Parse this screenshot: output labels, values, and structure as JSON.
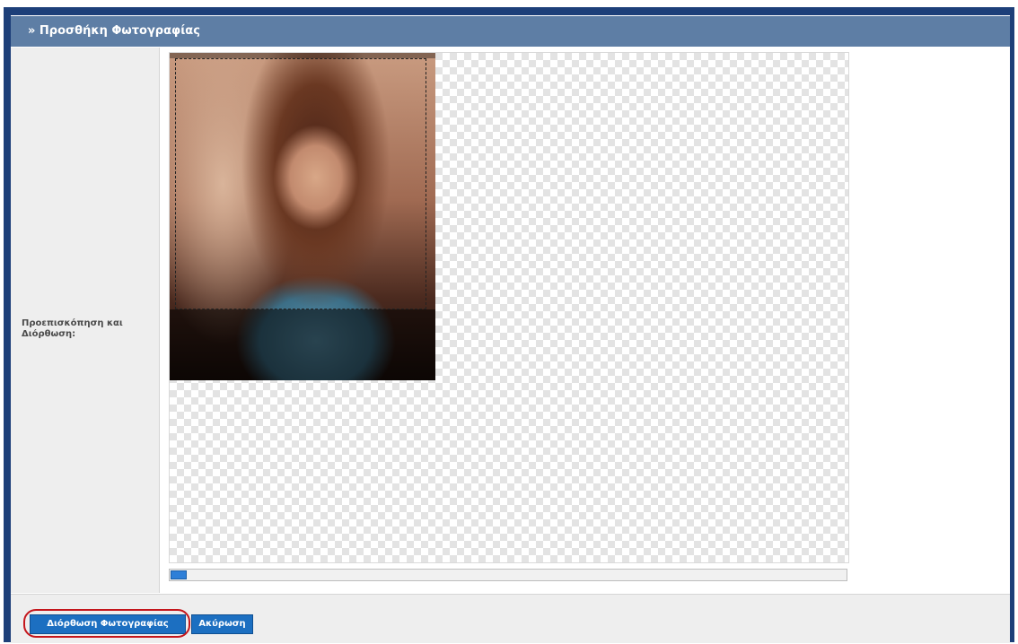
{
  "header": {
    "title": "» Προσθήκη Φωτογραφίας"
  },
  "form": {
    "preview_label": "Προεπισκόπηση και Διόρθωση:"
  },
  "buttons": {
    "edit_label": "Διόρθωση Φωτογραφίας",
    "cancel_label": "Ακύρωση"
  },
  "colors": {
    "header_bg": "#5e7ea5",
    "frame": "#1d3f79",
    "button_bg": "#1c6fc1",
    "highlight": "#c4161c"
  },
  "zoom_slider": {
    "value_fraction": 0.0
  }
}
